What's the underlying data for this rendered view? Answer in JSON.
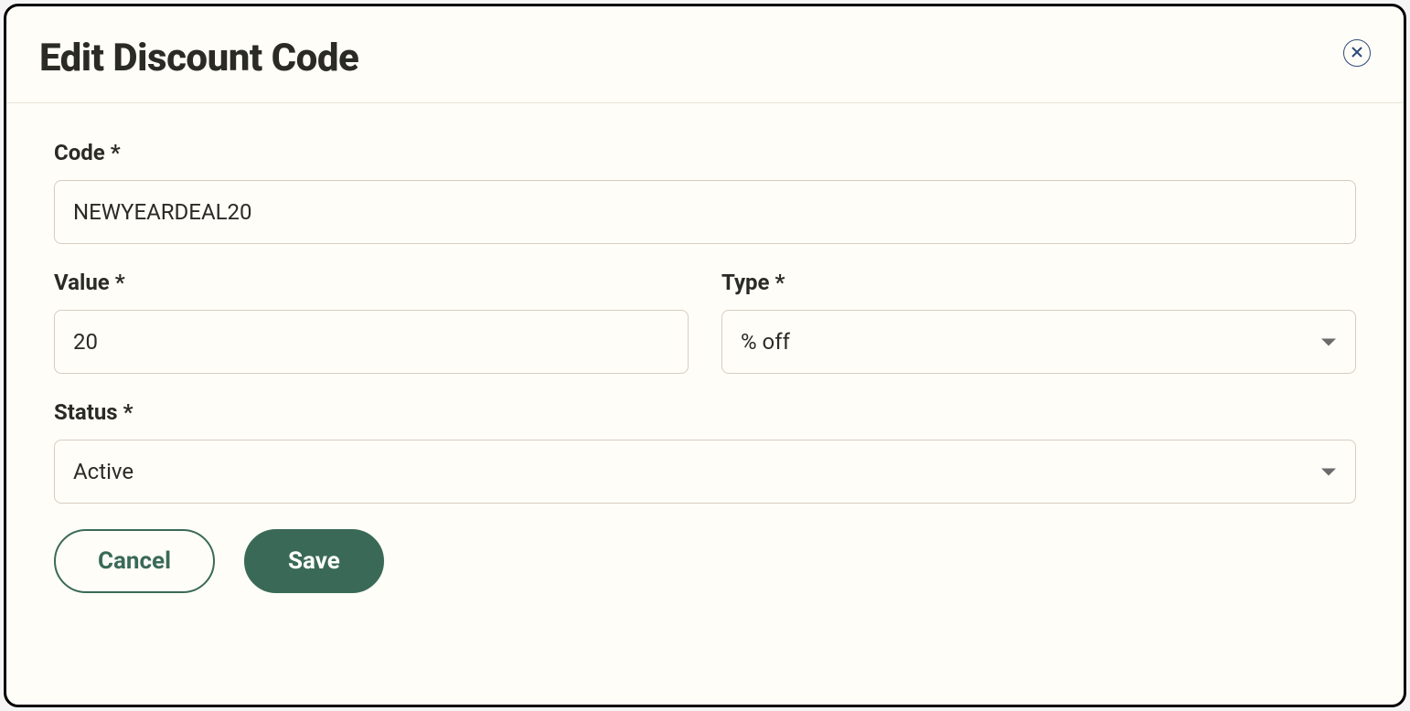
{
  "modal": {
    "title": "Edit Discount Code",
    "fields": {
      "code": {
        "label": "Code *",
        "value": "NEWYEARDEAL20"
      },
      "value": {
        "label": "Value *",
        "value": "20"
      },
      "type": {
        "label": "Type *",
        "selected": "% off"
      },
      "status": {
        "label": "Status *",
        "selected": "Active"
      }
    },
    "actions": {
      "cancel": "Cancel",
      "save": "Save"
    }
  }
}
